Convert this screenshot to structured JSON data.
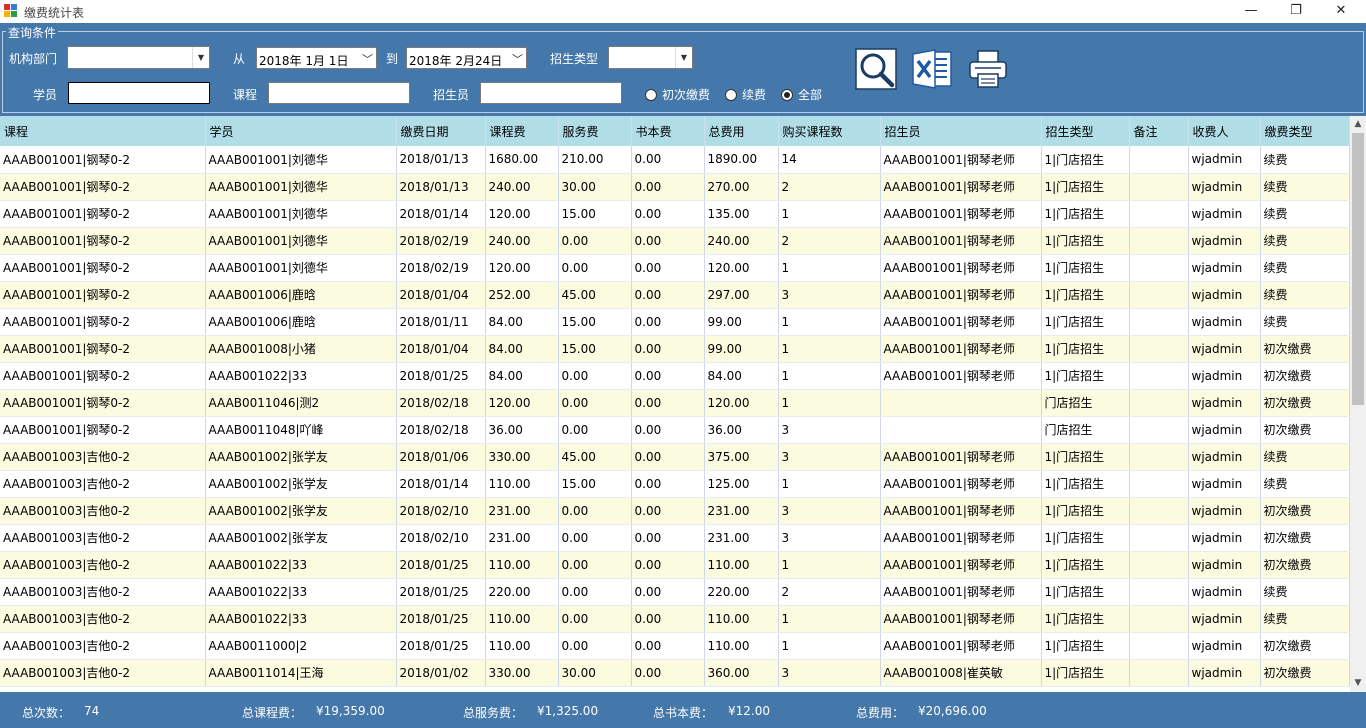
{
  "window": {
    "title": "缴费统计表",
    "minimize": "—",
    "restore": "❐",
    "close": "✕"
  },
  "query": {
    "legend": "查询条件",
    "org_label": "机构部门",
    "org_value": "",
    "from_label": "从",
    "from_date": "2018年  1月  1日",
    "to_label": "到",
    "to_date": "2018年  2月24日",
    "enroll_type_label": "招生类型",
    "enroll_type_value": "",
    "student_label": "学员",
    "student_value": "",
    "course_label": "课程",
    "course_value": "",
    "recruiter_label": "招生员",
    "recruiter_value": "",
    "radios": [
      {
        "label": "初次缴费",
        "checked": false
      },
      {
        "label": "续费",
        "checked": false
      },
      {
        "label": "全部",
        "checked": true
      }
    ],
    "tools": [
      "search-icon",
      "excel-icon",
      "printer-icon"
    ]
  },
  "colors": {
    "panel": "#4477aa",
    "header": "#b0dde6",
    "row_alt": "#fbfbe0",
    "excel_blue": "#1e5aa8"
  },
  "table": {
    "columns": [
      "课程",
      "学员",
      "缴费日期",
      "课程费",
      "服务费",
      "书本费",
      "总费用",
      "购买课程数",
      "招生员",
      "招生类型",
      "备注",
      "收费人",
      "缴费类型"
    ],
    "rows": [
      [
        "AAAB001001|钢琴0-2",
        "AAAB001001|刘德华",
        "2018/01/13",
        "1680.00",
        "210.00",
        "0.00",
        "1890.00",
        "14",
        "AAAB001001|钢琴老师",
        "1|门店招生",
        "",
        "wjadmin",
        "续费"
      ],
      [
        "AAAB001001|钢琴0-2",
        "AAAB001001|刘德华",
        "2018/01/13",
        "240.00",
        "30.00",
        "0.00",
        "270.00",
        "2",
        "AAAB001001|钢琴老师",
        "1|门店招生",
        "",
        "wjadmin",
        "续费"
      ],
      [
        "AAAB001001|钢琴0-2",
        "AAAB001001|刘德华",
        "2018/01/14",
        "120.00",
        "15.00",
        "0.00",
        "135.00",
        "1",
        "AAAB001001|钢琴老师",
        "1|门店招生",
        "",
        "wjadmin",
        "续费"
      ],
      [
        "AAAB001001|钢琴0-2",
        "AAAB001001|刘德华",
        "2018/02/19",
        "240.00",
        "0.00",
        "0.00",
        "240.00",
        "2",
        "AAAB001001|钢琴老师",
        "1|门店招生",
        "",
        "wjadmin",
        "续费"
      ],
      [
        "AAAB001001|钢琴0-2",
        "AAAB001001|刘德华",
        "2018/02/19",
        "120.00",
        "0.00",
        "0.00",
        "120.00",
        "1",
        "AAAB001001|钢琴老师",
        "1|门店招生",
        "",
        "wjadmin",
        "续费"
      ],
      [
        "AAAB001001|钢琴0-2",
        "AAAB001006|鹿晗",
        "2018/01/04",
        "252.00",
        "45.00",
        "0.00",
        "297.00",
        "3",
        "AAAB001001|钢琴老师",
        "1|门店招生",
        "",
        "wjadmin",
        "续费"
      ],
      [
        "AAAB001001|钢琴0-2",
        "AAAB001006|鹿晗",
        "2018/01/11",
        "84.00",
        "15.00",
        "0.00",
        "99.00",
        "1",
        "AAAB001001|钢琴老师",
        "1|门店招生",
        "",
        "wjadmin",
        "续费"
      ],
      [
        "AAAB001001|钢琴0-2",
        "AAAB001008|小猪",
        "2018/01/04",
        "84.00",
        "15.00",
        "0.00",
        "99.00",
        "1",
        "AAAB001001|钢琴老师",
        "1|门店招生",
        "",
        "wjadmin",
        "初次缴费"
      ],
      [
        "AAAB001001|钢琴0-2",
        "AAAB001022|33",
        "2018/01/25",
        "84.00",
        "0.00",
        "0.00",
        "84.00",
        "1",
        "AAAB001001|钢琴老师",
        "1|门店招生",
        "",
        "wjadmin",
        "初次缴费"
      ],
      [
        "AAAB001001|钢琴0-2",
        "AAAB0011046|测2",
        "2018/02/18",
        "120.00",
        "0.00",
        "0.00",
        "120.00",
        "1",
        "",
        "门店招生",
        "",
        "wjadmin",
        "初次缴费"
      ],
      [
        "AAAB001001|钢琴0-2",
        "AAAB0011048|吖峰",
        "2018/02/18",
        "36.00",
        "0.00",
        "0.00",
        "36.00",
        "3",
        "",
        "门店招生",
        "",
        "wjadmin",
        "初次缴费"
      ],
      [
        "AAAB001003|吉他0-2",
        "AAAB001002|张学友",
        "2018/01/06",
        "330.00",
        "45.00",
        "0.00",
        "375.00",
        "3",
        "AAAB001001|钢琴老师",
        "1|门店招生",
        "",
        "wjadmin",
        "续费"
      ],
      [
        "AAAB001003|吉他0-2",
        "AAAB001002|张学友",
        "2018/01/14",
        "110.00",
        "15.00",
        "0.00",
        "125.00",
        "1",
        "AAAB001001|钢琴老师",
        "1|门店招生",
        "",
        "wjadmin",
        "续费"
      ],
      [
        "AAAB001003|吉他0-2",
        "AAAB001002|张学友",
        "2018/02/10",
        "231.00",
        "0.00",
        "0.00",
        "231.00",
        "3",
        "AAAB001001|钢琴老师",
        "1|门店招生",
        "",
        "wjadmin",
        "初次缴费"
      ],
      [
        "AAAB001003|吉他0-2",
        "AAAB001002|张学友",
        "2018/02/10",
        "231.00",
        "0.00",
        "0.00",
        "231.00",
        "3",
        "AAAB001001|钢琴老师",
        "1|门店招生",
        "",
        "wjadmin",
        "初次缴费"
      ],
      [
        "AAAB001003|吉他0-2",
        "AAAB001022|33",
        "2018/01/25",
        "110.00",
        "0.00",
        "0.00",
        "110.00",
        "1",
        "AAAB001001|钢琴老师",
        "1|门店招生",
        "",
        "wjadmin",
        "初次缴费"
      ],
      [
        "AAAB001003|吉他0-2",
        "AAAB001022|33",
        "2018/01/25",
        "220.00",
        "0.00",
        "0.00",
        "220.00",
        "2",
        "AAAB001001|钢琴老师",
        "1|门店招生",
        "",
        "wjadmin",
        "续费"
      ],
      [
        "AAAB001003|吉他0-2",
        "AAAB001022|33",
        "2018/01/25",
        "110.00",
        "0.00",
        "0.00",
        "110.00",
        "1",
        "AAAB001001|钢琴老师",
        "1|门店招生",
        "",
        "wjadmin",
        "续费"
      ],
      [
        "AAAB001003|吉他0-2",
        "AAAB0011000|2",
        "2018/01/25",
        "110.00",
        "0.00",
        "0.00",
        "110.00",
        "1",
        "AAAB001001|钢琴老师",
        "1|门店招生",
        "",
        "wjadmin",
        "初次缴费"
      ],
      [
        "AAAB001003|吉他0-2",
        "AAAB0011014|王海",
        "2018/01/02",
        "330.00",
        "30.00",
        "0.00",
        "360.00",
        "3",
        "AAAB001008|崔英敏",
        "1|门店招生",
        "",
        "wjadmin",
        "初次缴费"
      ]
    ]
  },
  "summary": {
    "count_label": "总次数：",
    "count_value": "74",
    "course_fee_label": "总课程费：",
    "course_fee_value": "¥19,359.00",
    "service_fee_label": "总服务费：",
    "service_fee_value": "¥1,325.00",
    "book_fee_label": "总书本费：",
    "book_fee_value": "¥12.00",
    "total_label": "总费用：",
    "total_value": "¥20,696.00"
  }
}
